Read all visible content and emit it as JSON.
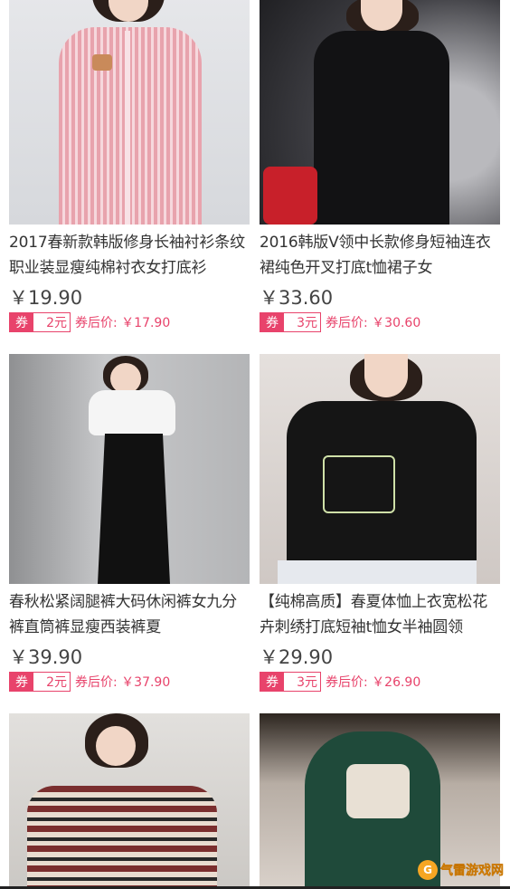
{
  "currency_symbol": "¥",
  "coupon_tag": "券",
  "products": [
    {
      "title": "2017春新款韩版修身长袖衬衫条纹职业装显瘦纯棉衬衣女打底衫",
      "price": "￥19.90",
      "coupon": "2元",
      "after_price": "券后价: ￥17.90"
    },
    {
      "title": "2016韩版V领中长款修身短袖连衣裙纯色开叉打底t恤裙子女",
      "price": "￥33.60",
      "coupon": "3元",
      "after_price": "券后价: ￥30.60"
    },
    {
      "title": "春秋松紧阔腿裤大码休闲裤女九分裤直筒裤显瘦西装裤夏",
      "price": "￥39.90",
      "coupon": "2元",
      "after_price": "券后价: ￥37.90"
    },
    {
      "title": "【纯棉高质】春夏体恤上衣宽松花卉刺绣打底短袖t恤女半袖圆领",
      "price": "￥29.90",
      "coupon": "3元",
      "after_price": "券后价: ￥26.90"
    },
    {
      "title": "",
      "price": "",
      "coupon": "",
      "after_price": ""
    },
    {
      "title": "",
      "price": "",
      "coupon": "",
      "after_price": ""
    }
  ],
  "watermark": {
    "logo_glyph": "G",
    "text": "气雷游戏网"
  },
  "colors": {
    "accent": "#e8436b",
    "text": "#333333",
    "price": "#444444"
  }
}
